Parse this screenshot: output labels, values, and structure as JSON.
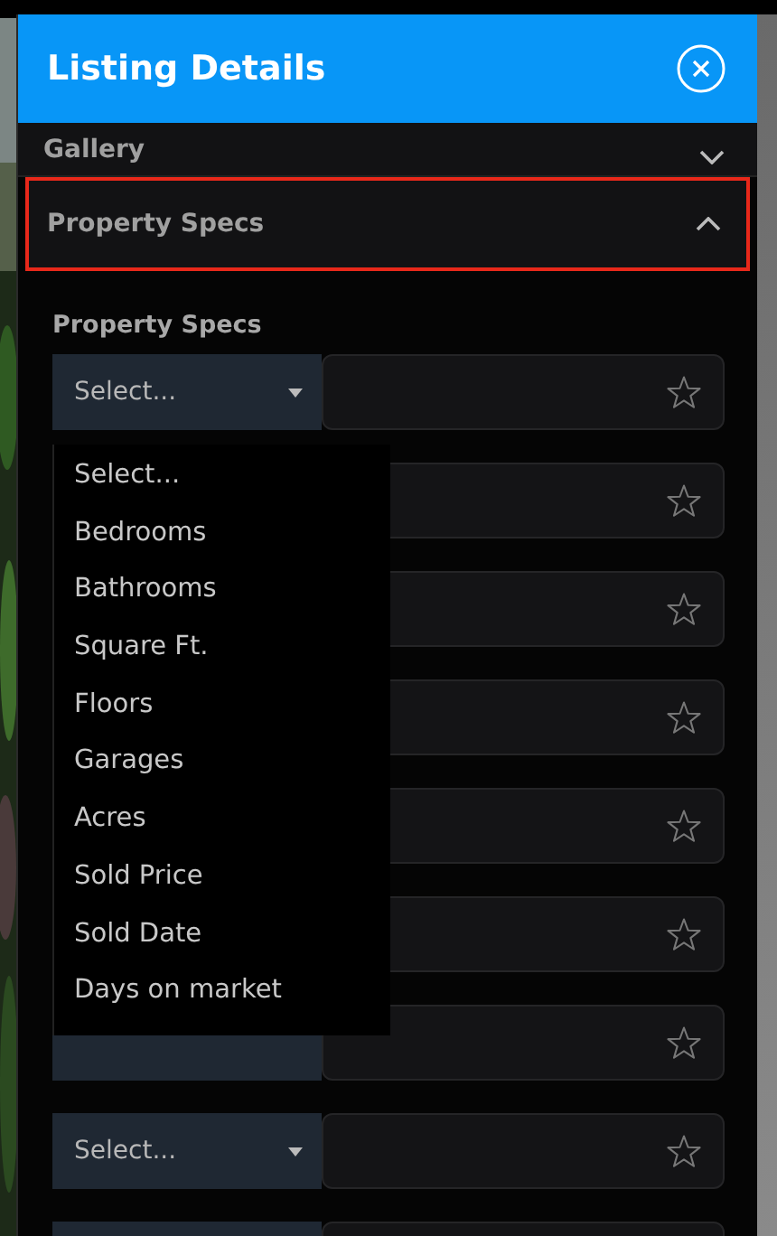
{
  "header": {
    "title": "Listing Details"
  },
  "sections": [
    {
      "label": "Gallery",
      "expanded": false,
      "selected": false
    },
    {
      "label": "Property Specs",
      "expanded": true,
      "selected": true
    }
  ],
  "specs": {
    "label": "Property Specs",
    "rows": [
      {
        "select": "Select..."
      },
      {},
      {},
      {},
      {},
      {},
      {},
      {
        "select": "Select..."
      },
      {}
    ],
    "dropdown": [
      "Select...",
      "Bedrooms",
      "Bathrooms",
      "Square Ft.",
      "Floors",
      "Garages",
      "Acres",
      "Sold Price",
      "Sold Date",
      "Days on market"
    ]
  }
}
